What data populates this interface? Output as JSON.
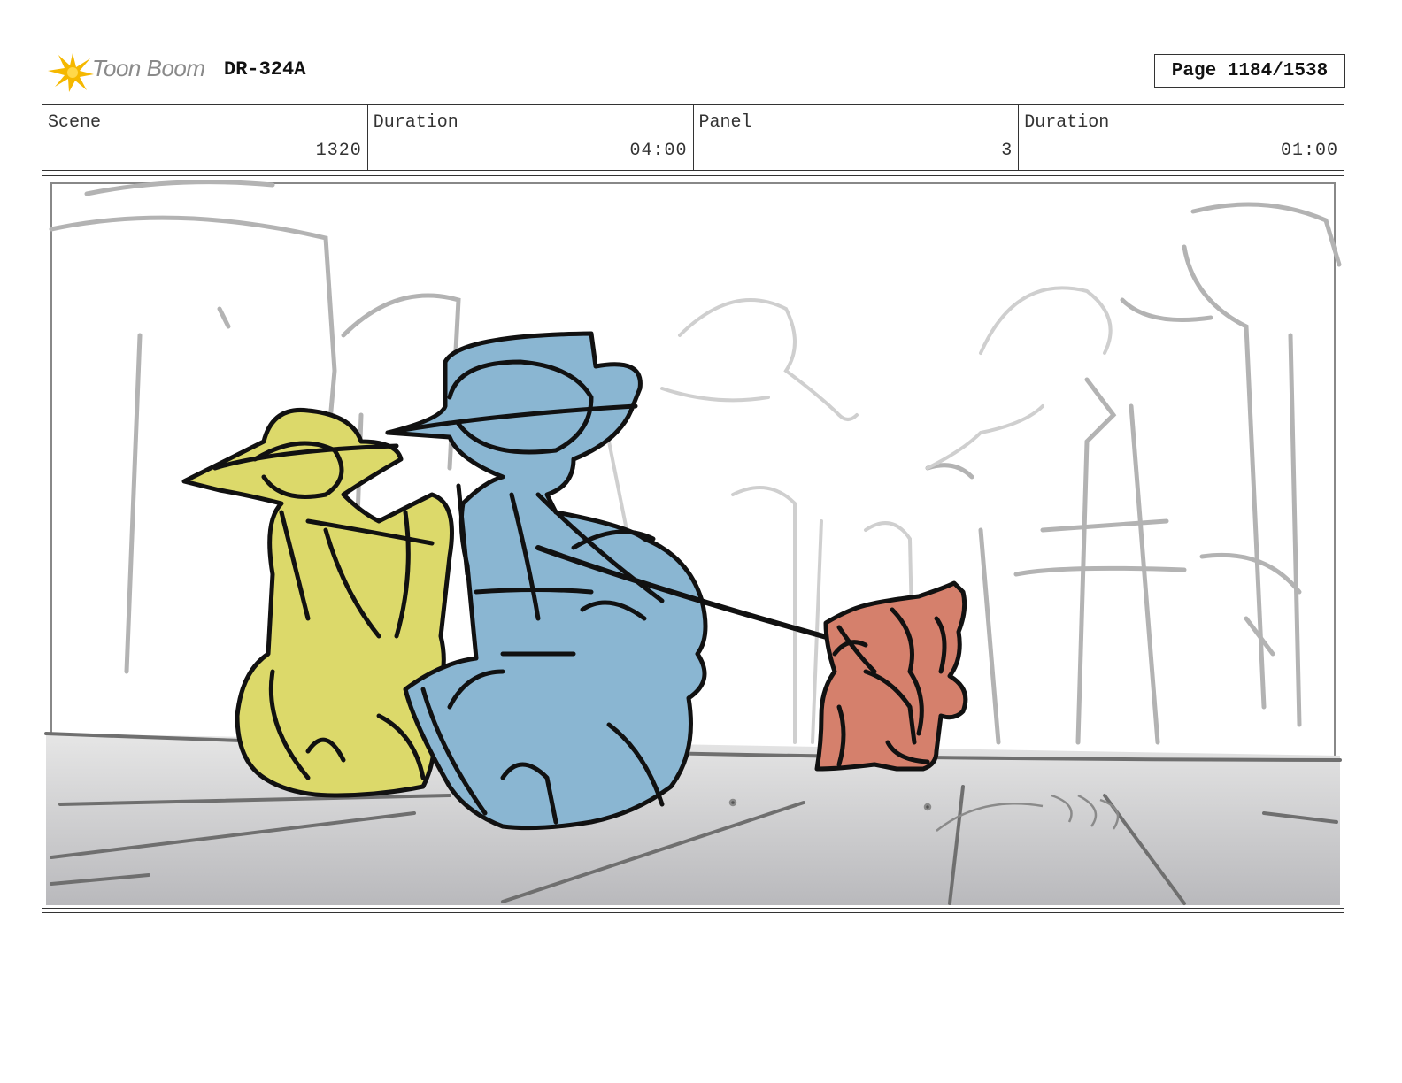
{
  "header": {
    "logo_text": "Toon Boom",
    "project_code": "DR-324A",
    "page_label": "Page 1184/1538"
  },
  "info": [
    {
      "label": "Scene",
      "value": "1320"
    },
    {
      "label": "Duration",
      "value": "04:00"
    },
    {
      "label": "Panel",
      "value": "3"
    },
    {
      "label": "Duration",
      "value": "01:00"
    }
  ],
  "panel": {
    "colors": {
      "yellow_character": "#dcd96a",
      "blue_character": "#8ab6d2",
      "red_character": "#d5806c",
      "ground": "#c9c9c9",
      "sketch_lines": "#b0b0b0"
    }
  },
  "notes": {
    "text": ""
  }
}
